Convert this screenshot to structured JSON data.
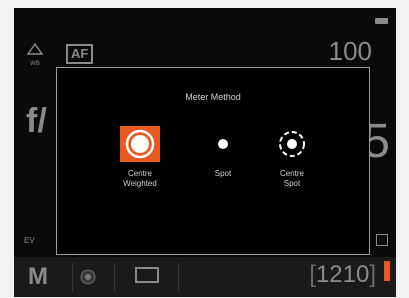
{
  "top": {
    "left_icon_label": "WB",
    "af_label": "AF",
    "iso_value": "100"
  },
  "middle": {
    "aperture_prefix": "f/",
    "right_value_fragment": "5"
  },
  "dialog": {
    "title": "Meter Method",
    "options": [
      {
        "label": "Centre\nWeighted",
        "selected": true
      },
      {
        "label": "Spot",
        "selected": false
      },
      {
        "label": "Centre\nSpot",
        "selected": false
      }
    ]
  },
  "ev": {
    "label": "EV"
  },
  "bottom": {
    "mode": "M",
    "shots_remaining": "1210"
  },
  "colors": {
    "accent": "#e8581f",
    "background": "#0a0a0a"
  }
}
